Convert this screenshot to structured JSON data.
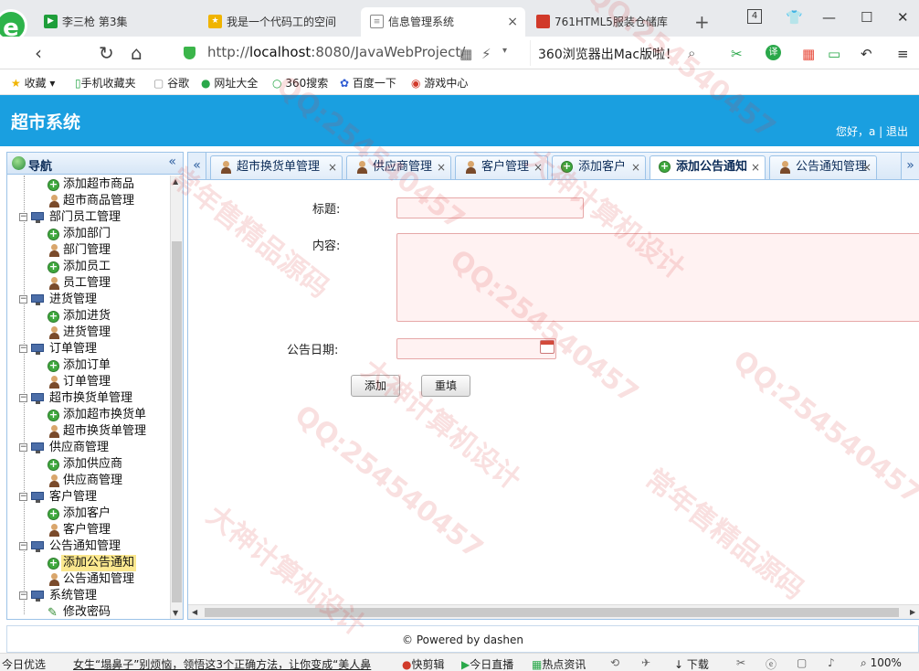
{
  "browser": {
    "tabs": [
      {
        "label": "李三枪 第3集",
        "icon": "video-site-icon",
        "color": "#1e9e3a",
        "active": false
      },
      {
        "label": "我是一个代码工的空间",
        "icon": "star-icon",
        "color": "#f0b400",
        "active": false
      },
      {
        "label": "信息管理系统",
        "icon": "page-icon",
        "color": "#888888",
        "active": true
      },
      {
        "label": "761HTML5服装仓储库",
        "icon": "red-square-icon",
        "color": "#d13a2a",
        "active": false
      }
    ],
    "tab_count": "4",
    "url_host": "http://",
    "url_main": "localhost",
    "url_rest": ":8080/JavaWebProject/",
    "search_text": "360浏览器出Mac版啦！",
    "bookmarks": [
      "收藏",
      "手机收藏夹",
      "谷歌",
      "网址大全",
      "360搜索",
      "百度一下",
      "游戏中心"
    ]
  },
  "app": {
    "title": "超市系统",
    "user_greeting": "您好，a | 退出",
    "accent_color": "#1a9fe0"
  },
  "nav": {
    "title": "导航",
    "rows": [
      {
        "label": "添加超市商品",
        "type": "add"
      },
      {
        "label": "超市商品管理",
        "type": "user"
      },
      {
        "label": "部门员工管理",
        "type": "group"
      },
      {
        "label": "添加部门",
        "type": "add"
      },
      {
        "label": "部门管理",
        "type": "user"
      },
      {
        "label": "添加员工",
        "type": "add"
      },
      {
        "label": "员工管理",
        "type": "user"
      },
      {
        "label": "进货管理",
        "type": "group"
      },
      {
        "label": "添加进货",
        "type": "add"
      },
      {
        "label": "进货管理",
        "type": "user"
      },
      {
        "label": "订单管理",
        "type": "group"
      },
      {
        "label": "添加订单",
        "type": "add"
      },
      {
        "label": "订单管理",
        "type": "user"
      },
      {
        "label": "超市换货单管理",
        "type": "group"
      },
      {
        "label": "添加超市换货单",
        "type": "add"
      },
      {
        "label": "超市换货单管理",
        "type": "user"
      },
      {
        "label": "供应商管理",
        "type": "group"
      },
      {
        "label": "添加供应商",
        "type": "add"
      },
      {
        "label": "供应商管理",
        "type": "user"
      },
      {
        "label": "客户管理",
        "type": "group"
      },
      {
        "label": "添加客户",
        "type": "add"
      },
      {
        "label": "客户管理",
        "type": "user"
      },
      {
        "label": "公告通知管理",
        "type": "group"
      },
      {
        "label": "添加公告通知",
        "type": "add",
        "selected": true
      },
      {
        "label": "公告通知管理",
        "type": "user"
      },
      {
        "label": "系统管理",
        "type": "group"
      },
      {
        "label": "修改密码",
        "type": "pen"
      }
    ]
  },
  "content_tabs": [
    {
      "label": "超市换货单管理",
      "type": "user"
    },
    {
      "label": "供应商管理",
      "type": "user"
    },
    {
      "label": "客户管理",
      "type": "user"
    },
    {
      "label": "添加客户",
      "type": "add"
    },
    {
      "label": "添加公告通知",
      "type": "add",
      "active": true
    },
    {
      "label": "公告通知管理",
      "type": "user"
    }
  ],
  "form": {
    "title_label": "标题:",
    "title_value": "",
    "content_label": "内容:",
    "content_value": "",
    "date_label": "公告日期:",
    "date_value": "",
    "add_button": "添加",
    "reset_button": "重填"
  },
  "footer": "© Powered by dashen",
  "statusbar": [
    "今日优选",
    "女生“塌鼻子”别烦恼，领悟这3个正确方法，让你变成“美人鼻",
    "快剪辑",
    "今日直播",
    "热点资讯",
    "下载",
    "100%"
  ],
  "watermarks": [
    "QQ:254540457",
    "大神计算机设计",
    "常年售精品源码"
  ]
}
